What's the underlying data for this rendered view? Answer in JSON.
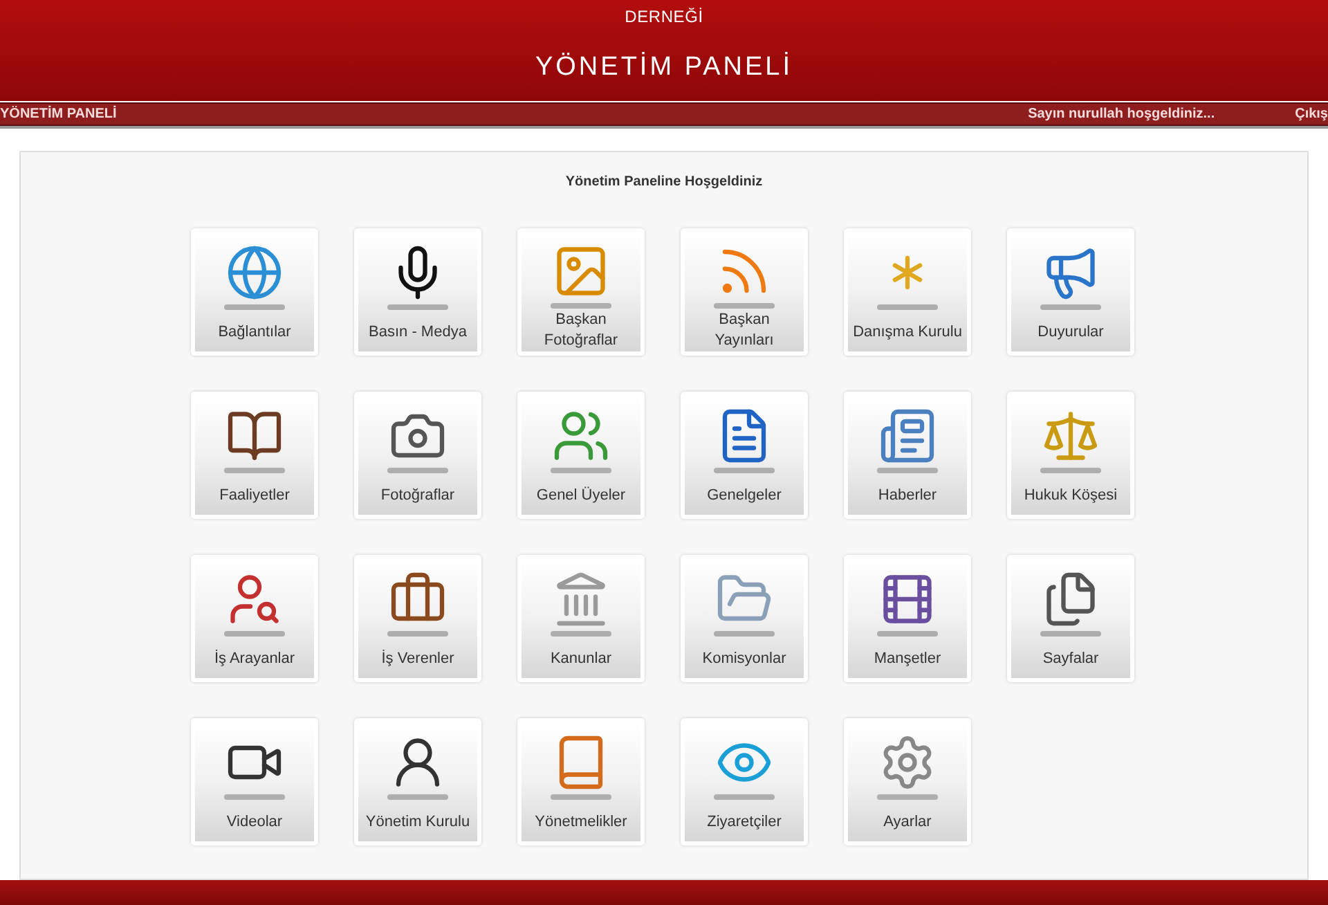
{
  "header": {
    "subtitle": "DERNEĞİ",
    "title": "YÖNETİM PANELİ"
  },
  "nav": {
    "left": "YÖNETİM PANELİ",
    "greeting": "Sayın nurullah hoşgeldiniz...",
    "logout": "Çıkış"
  },
  "panel": {
    "heading": "Yönetim Paneline Hoşgeldiniz",
    "tiles": [
      {
        "label": "Bağlantılar"
      },
      {
        "label": "Basın - Medya"
      },
      {
        "label": "Başkan Fotoğraflar"
      },
      {
        "label": "Başkan Yayınları"
      },
      {
        "label": "Danışma Kurulu"
      },
      {
        "label": "Duyurular"
      },
      {
        "label": "Faaliyetler"
      },
      {
        "label": "Fotoğraflar"
      },
      {
        "label": "Genel Üyeler"
      },
      {
        "label": "Genelgeler"
      },
      {
        "label": "Haberler"
      },
      {
        "label": "Hukuk Köşesi"
      },
      {
        "label": "İş Arayanlar"
      },
      {
        "label": "İş Verenler"
      },
      {
        "label": "Kanunlar"
      },
      {
        "label": "Komisyonlar"
      },
      {
        "label": "Manşetler"
      },
      {
        "label": "Sayfalar"
      },
      {
        "label": "Videolar"
      },
      {
        "label": "Yönetim Kurulu"
      },
      {
        "label": "Yönetmelikler"
      },
      {
        "label": "Ziyaretçiler"
      },
      {
        "label": "Ayarlar"
      }
    ]
  }
}
